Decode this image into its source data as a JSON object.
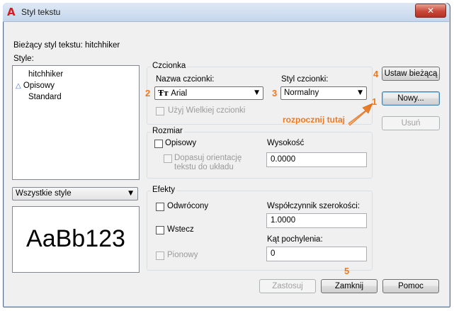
{
  "window": {
    "title": "Styl tekstu",
    "close_glyph": "✕",
    "app_icon": "autocad-logo-icon",
    "app_icon_glyph": "A"
  },
  "current_style": {
    "label": "Bieżący styl tekstu:",
    "value": "hitchhiker"
  },
  "styles": {
    "label": "Style:",
    "items": [
      {
        "label": "hitchhiker",
        "icon": ""
      },
      {
        "label": "Opisowy",
        "icon": "annotative-icon"
      },
      {
        "label": "Standard",
        "icon": ""
      }
    ],
    "filter_value": "Wszystkie style",
    "preview_text": "AaBb123"
  },
  "font": {
    "group_title": "Czcionka",
    "name_label": "Nazwa czcionki:",
    "name_value": "Arial",
    "name_icon": "truetype-icon",
    "style_label": "Styl czcionki:",
    "style_value": "Normalny",
    "big_font_label": "Użyj Wielkiej czcionki"
  },
  "size": {
    "group_title": "Rozmiar",
    "annotative_label": "Opisowy",
    "match_orientation_label_1": "Dopasuj orientację",
    "match_orientation_label_2": "tekstu do układu",
    "height_label": "Wysokość",
    "height_value": "0.0000"
  },
  "effects": {
    "group_title": "Efekty",
    "upside_down_label": "Odwrócony",
    "backwards_label": "Wstecz",
    "vertical_label": "Pionowy",
    "width_factor_label": "Współczynnik szerokości:",
    "width_factor_value": "1.0000",
    "oblique_label": "Kąt pochylenia:",
    "oblique_value": "0"
  },
  "buttons": {
    "set_current": "Ustaw bieżącą",
    "new": "Nowy...",
    "delete": "Usuń",
    "apply": "Zastosuj",
    "close": "Zamknij",
    "help": "Pomoc"
  },
  "annotations": {
    "n1": "1",
    "n2": "2",
    "n3": "3",
    "n4": "4",
    "n5": "5",
    "hint": "rozpocznij tutaj",
    "accent_color": "#f0781e"
  }
}
